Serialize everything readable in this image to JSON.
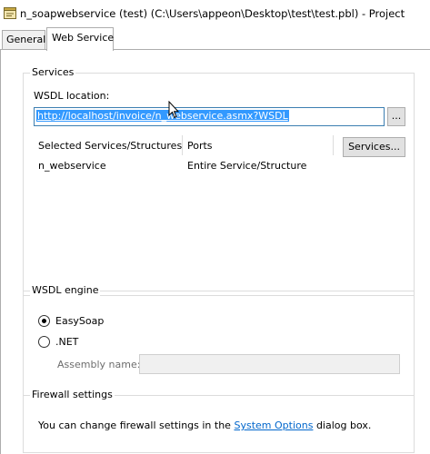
{
  "window": {
    "title": "n_soapwebservice (test) (C:\\Users\\appeon\\Desktop\\test\\test.pbl) - Project",
    "icon": "project-icon"
  },
  "tabs": [
    {
      "label": "General",
      "active": false
    },
    {
      "label": "Web Service",
      "active": true
    }
  ],
  "services": {
    "group_label": "Services",
    "wsdl_label": "WSDL location:",
    "wsdl_value": "http://localhost/invoice/n_webservice.asmx?WSDL",
    "browse_label": "...",
    "col_services": "Selected Services/Structures",
    "col_ports": "Ports",
    "services_button": "Services...",
    "rows": [
      {
        "service": "n_webservice",
        "port": "Entire Service/Structure"
      }
    ]
  },
  "wsdl_engine": {
    "group_label": "WSDL engine",
    "options": [
      {
        "label": "EasySoap",
        "selected": true
      },
      {
        "label": ".NET",
        "selected": false
      }
    ],
    "assembly_label": "Assembly name:",
    "assembly_value": ""
  },
  "firewall": {
    "group_label": "Firewall settings",
    "text_before": "You can change firewall settings in the",
    "link": "System Options",
    "text_after": "dialog box."
  },
  "colors": {
    "selection": "#3399ff",
    "link": "#0066cc",
    "focus_border": "#3c7fb1"
  }
}
